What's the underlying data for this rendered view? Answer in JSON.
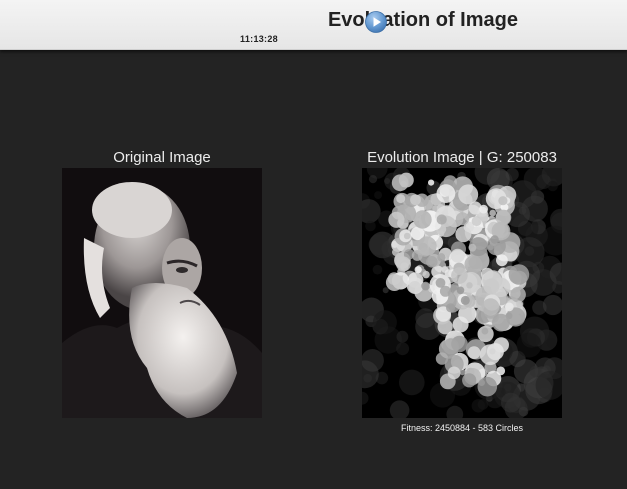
{
  "header": {
    "title": "Evoluation of Image",
    "clock": "11:13:28",
    "play_icon": "play-circle-icon",
    "accent_color": "#5f95cd"
  },
  "original": {
    "caption": "Original Image"
  },
  "evolution": {
    "caption": "Evolution Image | G: 250083",
    "fitness": "Fitness: 2450884 - 583 Circles"
  }
}
